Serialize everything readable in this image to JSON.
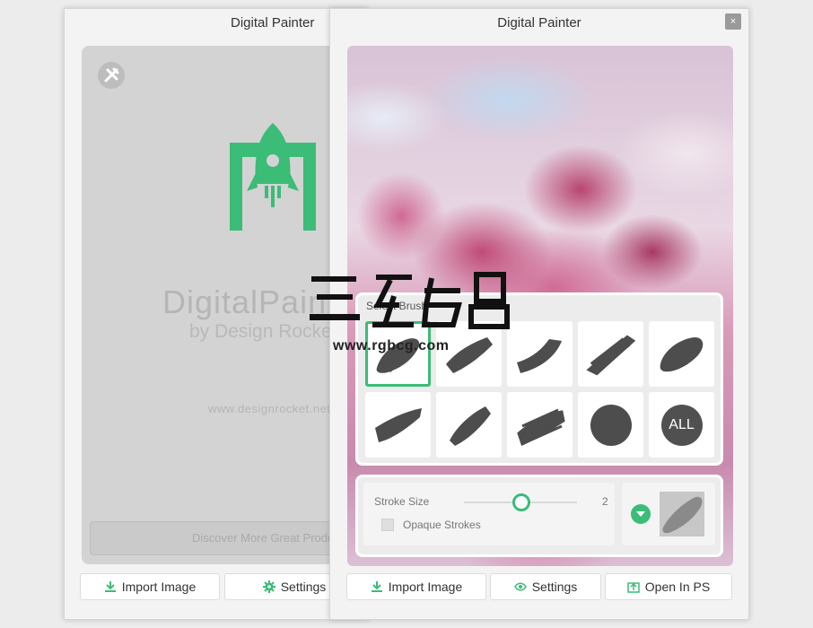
{
  "back_window": {
    "title": "Digital Painter",
    "brand": "DigitalPainter",
    "byline": "by Design Rocket",
    "url": "www.designrocket.net",
    "discover_label": "Discover More Great Products",
    "buttons": {
      "import": "Import Image",
      "settings": "Settings"
    }
  },
  "front_window": {
    "title": "Digital Painter",
    "close_glyph": "×",
    "brush_panel": {
      "title": "Select Brush",
      "brushes": [
        "brush-1",
        "brush-2",
        "brush-3",
        "brush-4",
        "brush-5",
        "brush-6",
        "brush-7",
        "brush-8",
        "brush-round"
      ],
      "all_label": "ALL",
      "selected_index": 0
    },
    "stroke": {
      "size_label": "Stroke Size",
      "size_value": "2",
      "opaque_label": "Opaque Strokes",
      "opaque_checked": false
    },
    "buttons": {
      "import": "Import Image",
      "settings": "Settings",
      "open_ps": "Open In PS"
    }
  },
  "watermark": {
    "url": "www.rgbcg.com"
  },
  "colors": {
    "accent": "#3bbc77",
    "panel": "#ececec",
    "brush": "#4d4d4d"
  }
}
